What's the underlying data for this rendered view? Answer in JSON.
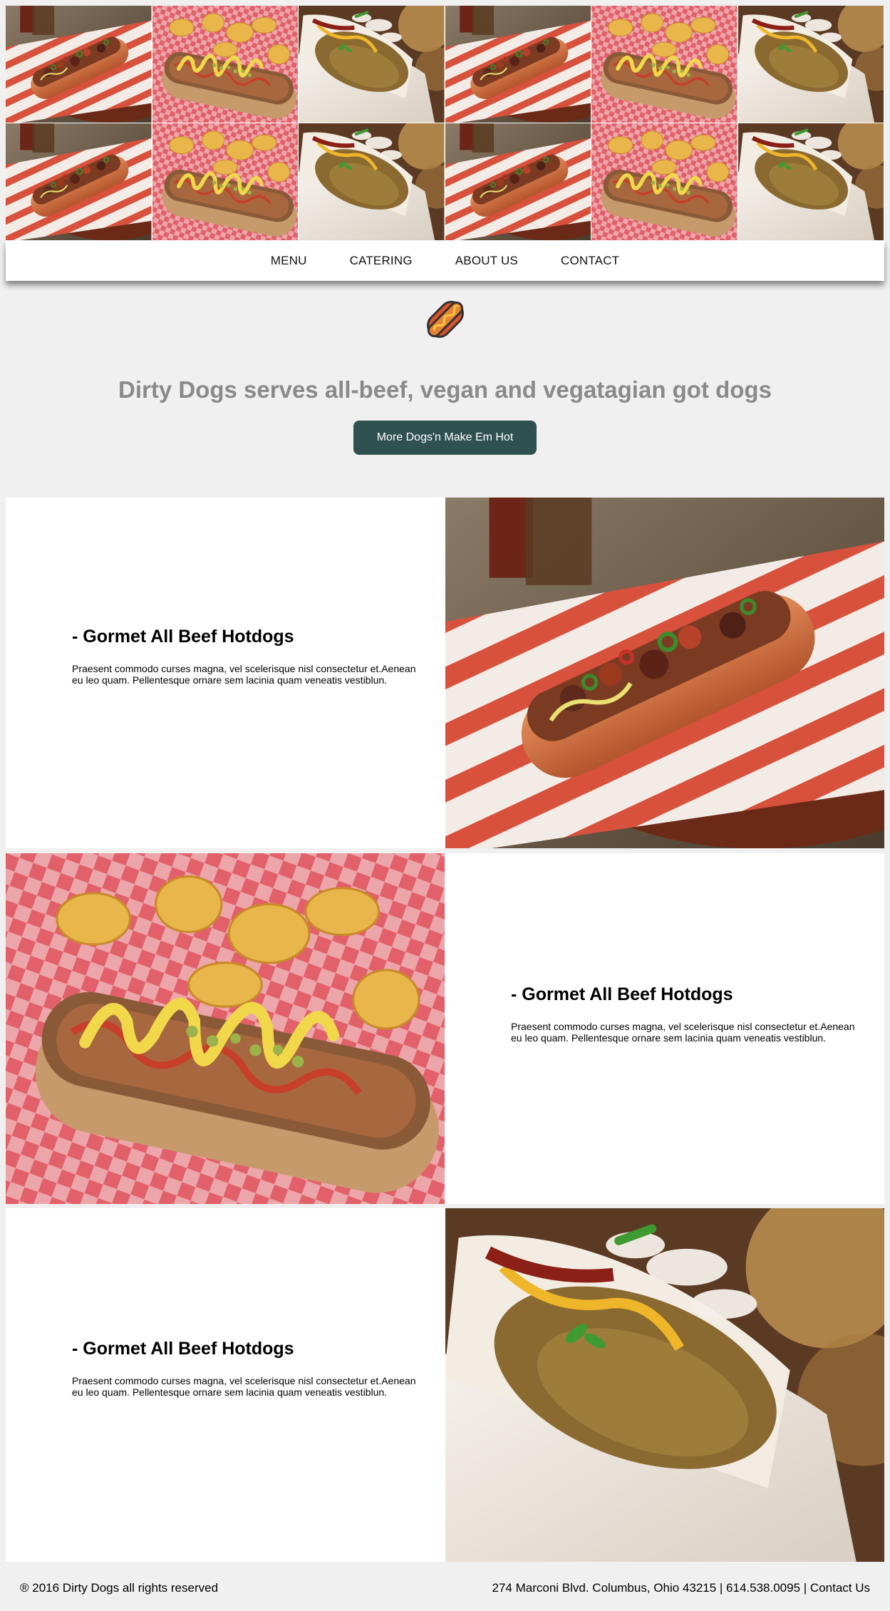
{
  "nav": {
    "items": [
      "MENU",
      "CATERING",
      "ABOUT US",
      "CONTACT"
    ]
  },
  "logo": {
    "icon": "hotdog-icon"
  },
  "hero": {
    "tagline": "Dirty Dogs serves all-beef, vegan and vegatagian got dogs",
    "cta_label": "More Dogs'n Make Em Hot"
  },
  "features": [
    {
      "title": "- Gormet All Beef Hotdogs",
      "body": "Praesent commodo curses magna, vel scelerisque nisl consectetur et.Aenean eu leo quam. Pellentesque ornare sem lacinia quam veneatis vestiblun."
    },
    {
      "title": "- Gormet All Beef Hotdogs",
      "body": "Praesent commodo curses magna, vel scelerisque nisl consectetur et.Aenean eu leo quam. Pellentesque ornare sem lacinia quam veneatis vestiblun."
    },
    {
      "title": "- Gormet All Beef Hotdogs",
      "body": "Praesent commodo curses magna, vel scelerisque nisl consectetur et.Aenean eu leo quam. Pellentesque ornare sem lacinia quam veneatis vestiblun."
    }
  ],
  "footer": {
    "copyright": "® 2016 Dirty Dogs all rights reserved",
    "contact": "274 Marconi Blvd. Columbus, Ohio 43215 | 614.538.0095 | Contact Us"
  },
  "colors": {
    "background": "#f0f0f0",
    "button": "#2f5150",
    "tagline": "#8a8a8a"
  }
}
